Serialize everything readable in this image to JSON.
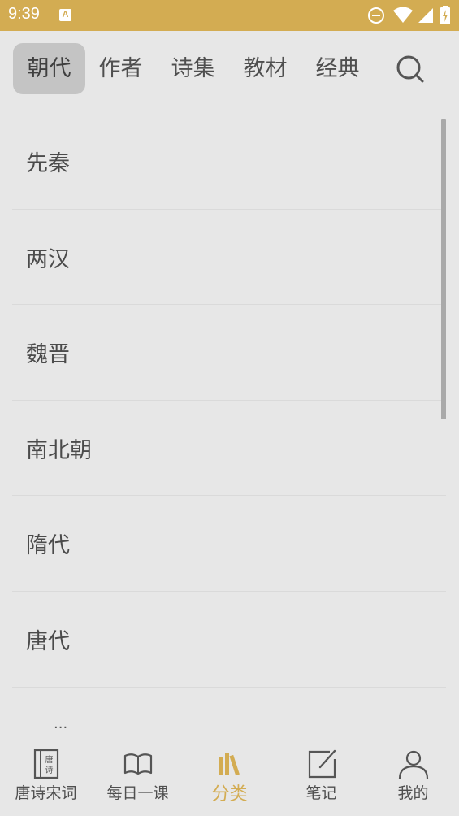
{
  "status_bar": {
    "time": "9:39",
    "notification_letter": "A",
    "bg_color": "#d3ac52"
  },
  "tabs": [
    {
      "label": "朝代",
      "active": true
    },
    {
      "label": "作者",
      "active": false
    },
    {
      "label": "诗集",
      "active": false
    },
    {
      "label": "教材",
      "active": false
    },
    {
      "label": "经典",
      "active": false
    }
  ],
  "search_icon": "search-icon",
  "list": {
    "items": [
      "先秦",
      "两汉",
      "魏晋",
      "南北朝",
      "隋代",
      "唐代"
    ],
    "partial_item": "..."
  },
  "bottom_nav": {
    "accent_color": "#d3ac52",
    "items": [
      {
        "label": "唐诗宋词",
        "icon": "poetry-book-icon",
        "icon_text_top": "唐",
        "icon_text_bottom": "诗"
      },
      {
        "label": "每日一课",
        "icon": "open-book-icon"
      },
      {
        "label": "分类",
        "icon": "bookshelf-icon",
        "active": true
      },
      {
        "label": "笔记",
        "icon": "edit-note-icon"
      },
      {
        "label": "我的",
        "icon": "person-icon"
      }
    ]
  }
}
